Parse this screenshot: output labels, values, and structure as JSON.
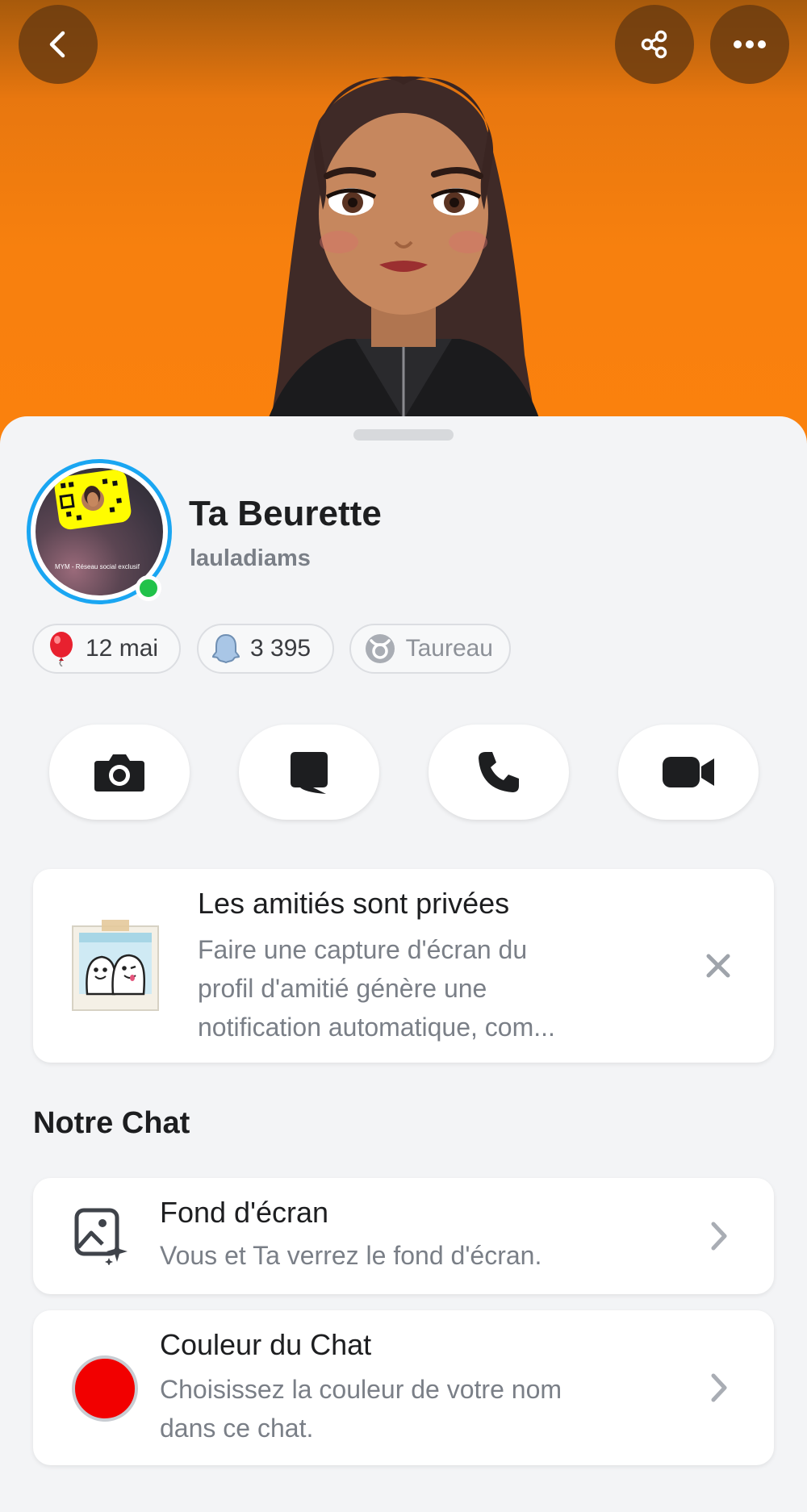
{
  "header": {
    "back_icon": "chevron-left-icon",
    "share_icon": "share-icon",
    "more_icon": "more-dots-icon"
  },
  "profile": {
    "display_name": "Ta Beurette",
    "username": "lauladiams",
    "snapcode_caption": "MYM - Réseau social exclusif"
  },
  "chips": [
    {
      "icon": "balloon-icon",
      "label": "12 mai"
    },
    {
      "icon": "ghost-score-icon",
      "label": "3 395"
    },
    {
      "icon": "taurus-icon",
      "label": "Taureau"
    }
  ],
  "actions": [
    {
      "icon": "camera-icon"
    },
    {
      "icon": "chat-icon"
    },
    {
      "icon": "phone-icon"
    },
    {
      "icon": "video-icon"
    }
  ],
  "privacy_card": {
    "title": "Les amitiés sont privées",
    "line1": "Faire une capture d'écran du",
    "line2": "profil d'amitié génère une",
    "line3": "notification automatique, com..."
  },
  "section": {
    "title": "Notre Chat"
  },
  "wallpaper_item": {
    "title": "Fond d'écran",
    "subtitle": "Vous et Ta verrez le fond d'écran."
  },
  "color_item": {
    "title": "Couleur du Chat",
    "line1": "Choisissez la couleur de votre nom",
    "line2": "dans ce chat.",
    "swatch_color": "#f20000"
  },
  "colors": {
    "hero_orange": "#fb810d",
    "accent_blue": "#1aa6f2",
    "online_green": "#21c24a"
  }
}
